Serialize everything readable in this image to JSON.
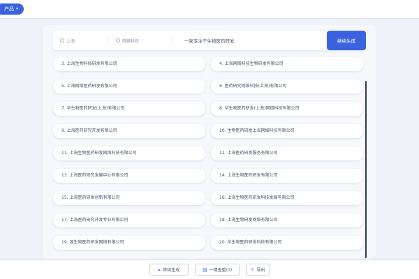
{
  "topbar": {
    "pill_label": "产品",
    "pill_icon": "chevron-down-icon"
  },
  "search": {
    "location": "上海",
    "category": "网络科技",
    "query": "一家专注于生物医药研发",
    "generate_label": "继续生成"
  },
  "results": [
    "3. 上海生物科技研发有限公司",
    "4. 上海网络科技生物研发有限公司",
    "5. 上海网络医药研发有限公司",
    "6. 医药研究网络科技(上海)有限公司",
    "7. 华生物医药研发(上海)有限公司",
    "8. 华生物医药研发(上海)网络科技有限公司",
    "9. 上海医药研究开发有限公司",
    "10. 生物医药研发上海网络科技有限公司",
    "11. 上海生物医药研发网络科技有限公司",
    "12. 上海医药研发服务有限公司",
    "13. 上海医药研究发展中心有限公司",
    "14. 上海生物医药研发有限公司",
    "15. 上海医药研发创新有限公司",
    "16. 上海生物医药研发科技发展有限公司",
    "17. 上海医药研究开发专业有限公司",
    "18. 上海生物研发网络有限公司",
    "19. 源生物医药研发网络有限公司",
    "20. 华生物医药研发科技有限公司"
  ],
  "footer": {
    "continue_label": "继续生成",
    "copy_label": "一键查重(0)",
    "export_label": "导出"
  }
}
